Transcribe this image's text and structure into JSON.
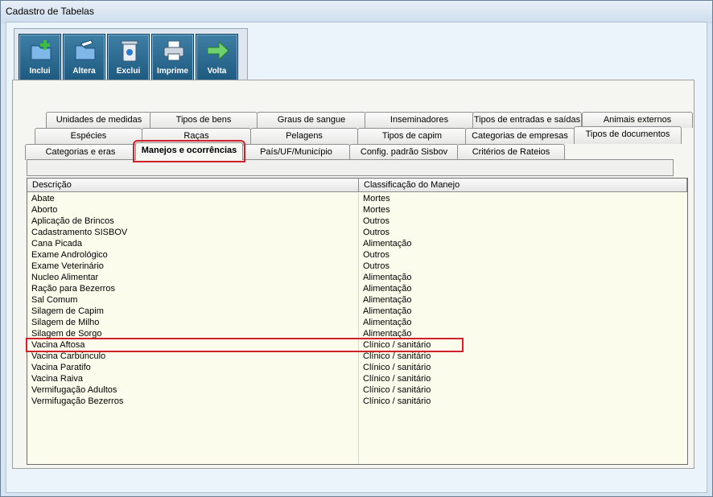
{
  "window": {
    "title": "Cadastro de Tabelas"
  },
  "toolbar": {
    "buttons": [
      {
        "label": "Inclui",
        "icon": "folder-add-icon"
      },
      {
        "label": "Altera",
        "icon": "folder-edit-icon"
      },
      {
        "label": "Exclui",
        "icon": "recycle-bin-icon"
      },
      {
        "label": "Imprime",
        "icon": "printer-icon"
      },
      {
        "label": "Volta",
        "icon": "arrow-right-icon"
      }
    ]
  },
  "tabs": {
    "row1": [
      "Unidades de medidas",
      "Tipos de bens",
      "Graus de sangue",
      "Inseminadores",
      "Tipos de entradas e saídas",
      "Animais externos"
    ],
    "row2": [
      "Espécies",
      "Raças",
      "Pelagens",
      "Tipos de capim",
      "Categorias de empresas",
      "Tipos de documentos"
    ],
    "row3": [
      "Categorias e eras",
      "Manejos e ocorrências",
      "País/UF/Município",
      "Config. padrão Sisbov",
      "Critérios de Rateios"
    ],
    "active": "Manejos e ocorrências"
  },
  "grid": {
    "columns": [
      "Descrição",
      "Classificação do Manejo"
    ],
    "rows": [
      [
        "Abate",
        "Mortes"
      ],
      [
        "Aborto",
        "Mortes"
      ],
      [
        "Aplicação de Brincos",
        "Outros"
      ],
      [
        "Cadastramento SISBOV",
        "Outros"
      ],
      [
        "Cana Picada",
        "Alimentação"
      ],
      [
        "Exame Andrológico",
        "Outros"
      ],
      [
        "Exame Veterinário",
        "Outros"
      ],
      [
        "Nucleo Alimentar",
        "Alimentação"
      ],
      [
        "Ração para Bezerros",
        "Alimentação"
      ],
      [
        "Sal Comum",
        "Alimentação"
      ],
      [
        "Silagem de Capim",
        "Alimentação"
      ],
      [
        "Silagem de Milho",
        "Alimentação"
      ],
      [
        "Silagem de Sorgo",
        "Alimentação"
      ],
      [
        "Vacina Aftosa",
        "Clínico / sanitário"
      ],
      [
        "Vacina Carbúnculo",
        "Clínico / sanitário"
      ],
      [
        "Vacina Paratifo",
        "Clínico / sanitário"
      ],
      [
        "Vacina Raiva",
        "Clínico / sanitário"
      ],
      [
        "Vermifugação Adultos",
        "Clínico / sanitário"
      ],
      [
        "Vermifugação Bezerros",
        "Clínico / sanitário"
      ]
    ],
    "highlighted_row": "Vacina Aftosa"
  }
}
